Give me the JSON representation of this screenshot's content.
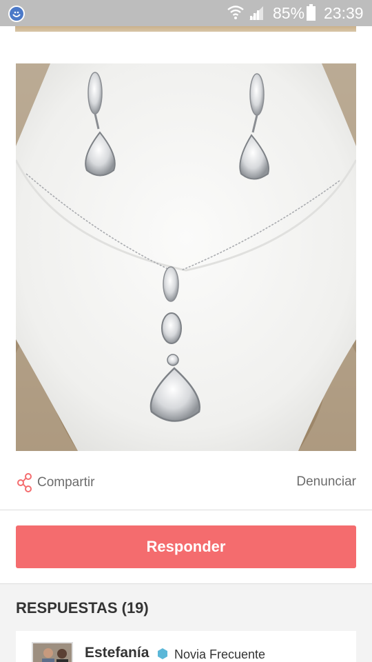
{
  "status_bar": {
    "battery_percent": "85%",
    "time": "23:39",
    "icons": [
      "app-notification-icon",
      "wifi-icon",
      "signal-icon",
      "battery-icon"
    ]
  },
  "post": {
    "image_alt": "necklace and earrings set",
    "share_label": "Compartir",
    "report_label": "Denunciar"
  },
  "reply_button": {
    "label": "Responder"
  },
  "answers": {
    "title": "RESPUESTAS (19)",
    "items": [
      {
        "author": "Estefanía",
        "role": "Novia Frecuente"
      }
    ]
  },
  "colors": {
    "accent": "#f46c6e",
    "status_bar": "#bdbdbd",
    "badge": "#5bb7d8"
  }
}
